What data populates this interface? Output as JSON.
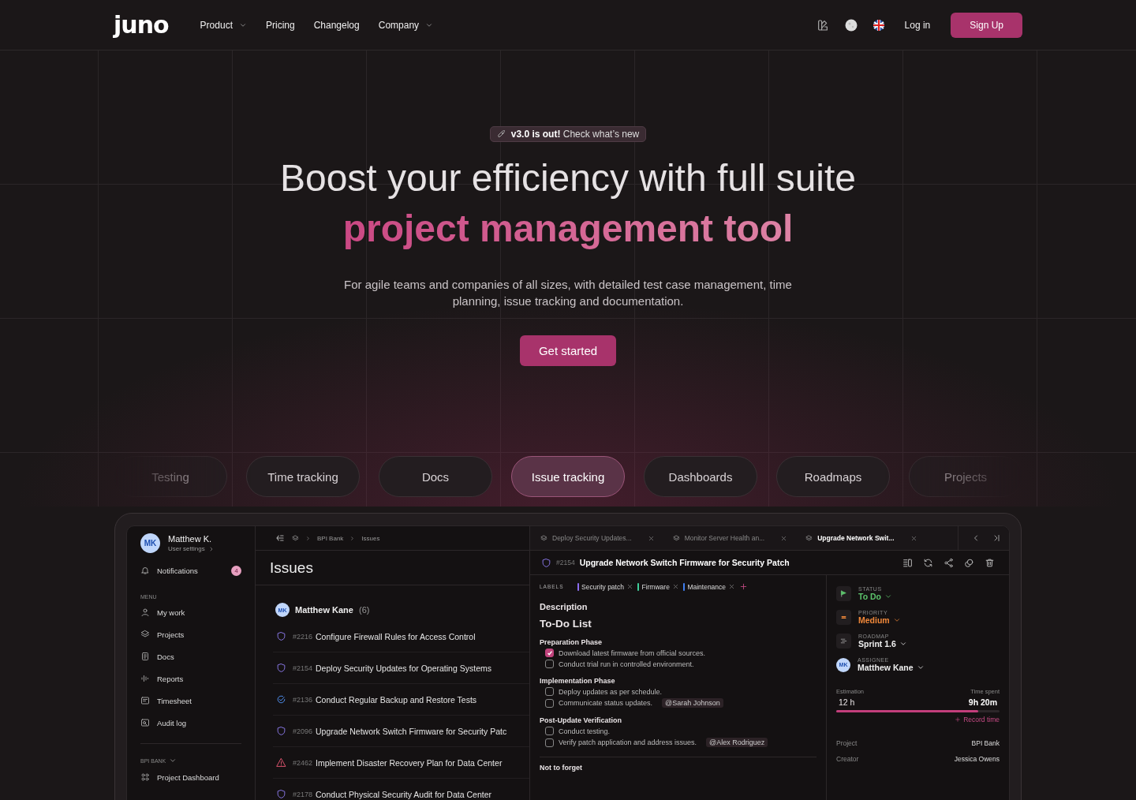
{
  "nav": {
    "logo": "juno",
    "links": [
      {
        "label": "Product",
        "dropdown": true
      },
      {
        "label": "Pricing",
        "dropdown": false
      },
      {
        "label": "Changelog",
        "dropdown": false
      },
      {
        "label": "Company",
        "dropdown": true
      }
    ],
    "login": "Log in",
    "signup": "Sign Up"
  },
  "hero": {
    "badge": "**v3.0 is out!** Check what’s new",
    "title": "Boost your efficiency with full suite",
    "title_accent": "project management tool",
    "subtitle": "For agile teams and companies of all sizes, with detailed test case management, time planning, issue tracking and documentation.",
    "cta": "Get started"
  },
  "features": [
    {
      "label": "Testing",
      "selected": false
    },
    {
      "label": "Time tracking",
      "selected": false
    },
    {
      "label": "Docs",
      "selected": false
    },
    {
      "label": "Issue tracking",
      "selected": true
    },
    {
      "label": "Dashboards",
      "selected": false
    },
    {
      "label": "Roadmaps",
      "selected": false
    },
    {
      "label": "Projects",
      "selected": false
    }
  ],
  "app": {
    "sidebar": {
      "user": {
        "initials": "MK",
        "name": "Matthew K.",
        "link": "User settings"
      },
      "notifications": {
        "label": "Notifications",
        "count": "4"
      },
      "menu_heading": "MENU",
      "menu": [
        "My work",
        "Projects",
        "Docs",
        "Reports",
        "Timesheet",
        "Audit log"
      ],
      "section_heading": "BPI BANK",
      "section_items": [
        "Project Dashboard"
      ]
    },
    "issues": {
      "breadcrumb": [
        "BPI Bank",
        "Issues"
      ],
      "title": "Issues",
      "group": {
        "initials": "MK",
        "name": "Matthew Kane",
        "count": "(6)"
      },
      "rows": [
        {
          "number": "#2216",
          "title": "Configure Firewall Rules for Access Control",
          "kind": "open"
        },
        {
          "number": "#2154",
          "title": "Deploy Security Updates for Operating Systems",
          "kind": "open"
        },
        {
          "number": "#2136",
          "title": "Conduct Regular Backup and Restore Tests",
          "kind": "done"
        },
        {
          "number": "#2096",
          "title": "Upgrade Network Switch Firmware for Security Patc",
          "kind": "open"
        },
        {
          "number": "#2462",
          "title": "Implement Disaster Recovery Plan for Data Center",
          "kind": "alert"
        },
        {
          "number": "#2178",
          "title": "Conduct Physical Security Audit for Data Center",
          "kind": "open"
        }
      ]
    },
    "detail": {
      "tabs": [
        {
          "label": "Deploy Security Updates...",
          "selected": false
        },
        {
          "label": "Monitor Server Health an...",
          "selected": false
        },
        {
          "label": "Upgrade Network Swit...",
          "selected": true
        }
      ],
      "number": "#2154",
      "title": "Upgrade Network Switch Firmware for Security Patch",
      "labels_heading": "LABELS",
      "labels": [
        {
          "name": "Security patch",
          "color": "#8b6cf0"
        },
        {
          "name": "Firmware",
          "color": "#3ecf9a"
        },
        {
          "name": "Maintenance",
          "color": "#3f7ff0"
        }
      ],
      "description": "Description",
      "todo_title": "To-Do List",
      "sections": [
        {
          "title": "Preparation Phase",
          "items": [
            {
              "text": "Download latest firmware from official sources.",
              "checked": true
            },
            {
              "text": "Conduct trial run in controlled environment.",
              "checked": false
            }
          ]
        },
        {
          "title": "Implementation Phase",
          "items": [
            {
              "text": "Deploy updates as per schedule.",
              "checked": false
            },
            {
              "text": "Communicate status updates.",
              "checked": false,
              "mention": "@Sarah Johnson"
            }
          ]
        },
        {
          "title": "Post-Update Verification",
          "items": [
            {
              "text": "Conduct testing.",
              "checked": false
            },
            {
              "text": "Verify patch application and address issues.",
              "checked": false,
              "mention": "@Alex Rodriguez"
            }
          ]
        }
      ],
      "not_to_forget": "Not to forget"
    },
    "props": {
      "fields": [
        {
          "kind": "status",
          "label": "STATUS",
          "value": "To Do"
        },
        {
          "kind": "priority",
          "label": "PRIORITY",
          "value": "Medium"
        },
        {
          "kind": "roadmap",
          "label": "ROADMAP",
          "value": "Sprint 1.6"
        },
        {
          "kind": "assignee",
          "label": "ASSIGNEE",
          "value": "Matthew Kane",
          "initials": "MK"
        }
      ],
      "estimation_label": "Estimation",
      "estimation": "12 h",
      "spent_label": "Time spent",
      "spent": "9h 20m",
      "level": 0.87,
      "record": "Record time",
      "meta": [
        {
          "label": "Project",
          "value": "BPI Bank"
        },
        {
          "label": "Creator",
          "value": "Jessica Owens"
        }
      ]
    }
  }
}
